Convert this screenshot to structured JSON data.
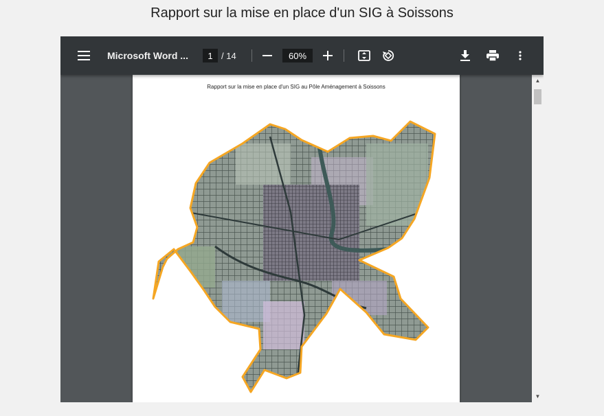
{
  "page": {
    "heading": "Rapport sur la mise en place d'un SIG à Soissons"
  },
  "toolbar": {
    "doc_title": "Microsoft Word ...",
    "current_page": "1",
    "page_total": "/ 14",
    "zoom": "60%",
    "icons": [
      "menu-icon",
      "zoom-out-icon",
      "zoom-in-icon",
      "fit-page-icon",
      "rotate-icon",
      "download-icon",
      "print-icon",
      "more-vert-icon"
    ]
  },
  "document": {
    "header": "Rapport sur la mise en place d'un SIG au Pôle Aménagement à Soissons"
  },
  "colors": {
    "toolbar_bg": "#323639",
    "viewer_bg": "#525659",
    "map_outline": "#f5a623"
  }
}
